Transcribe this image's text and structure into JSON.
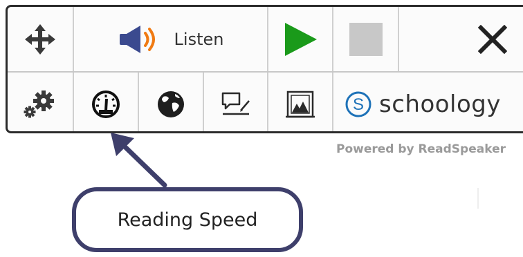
{
  "toolbar": {
    "listen_label": "Listen",
    "brand_label": "schoology"
  },
  "footer": {
    "powered_by": "Powered by ReadSpeaker"
  },
  "callout": {
    "label": "Reading Speed"
  },
  "icons": {
    "move": "move-arrows-icon",
    "speaker": "speaker-icon",
    "play": "play-icon",
    "stop": "stop-icon",
    "close": "close-icon",
    "settings": "settings-gears-icon",
    "speed": "speedometer-icon",
    "translate": "globe-icon",
    "notes": "text-note-icon",
    "picture": "picture-frame-icon",
    "brand_logo": "schoology-s-icon"
  },
  "colors": {
    "play": "#1a9a1a",
    "stop": "#c8c8c8",
    "speaker_waves": "#f07a12",
    "brand_logo": "#1e72b8",
    "callout_border": "#3e3f6b",
    "arrow": "#3e3f6b",
    "powered_text": "#9a9a9a"
  }
}
